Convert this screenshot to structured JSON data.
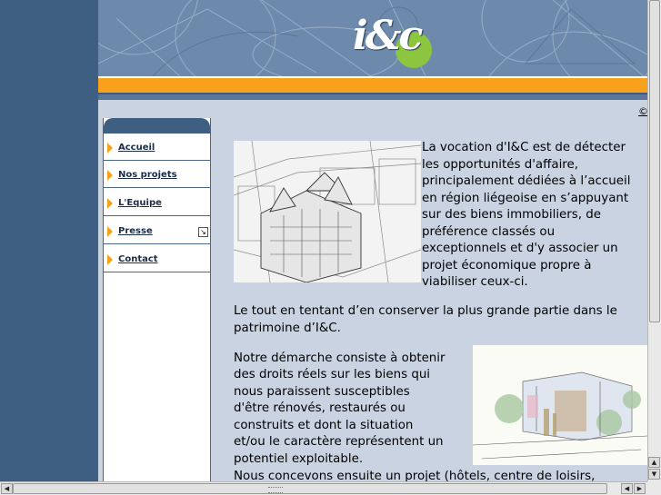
{
  "brand": {
    "logo_text": "i&c"
  },
  "copyright": "©",
  "nav": {
    "items": [
      {
        "label": "Accueil"
      },
      {
        "label": "Nos projets"
      },
      {
        "label": "L'Equipe"
      },
      {
        "label": "Presse"
      },
      {
        "label": "Contact"
      }
    ]
  },
  "content": {
    "p1_lines": [
      "La vocation d'I&C est de détecter",
      "les opportunités d'affaire,",
      "principalement dédiées à l’accueil",
      "en région liégeoise en s’appuyant",
      "sur des biens immobiliers, de",
      "préférence classés ou",
      "exceptionnels et d'y associer un",
      "projet économique propre à",
      "viabiliser ceux-ci."
    ],
    "p2_lines": [
      "Le tout en tentant d’en conserver la plus grande partie dans le",
      "patrimoine d’I&C."
    ],
    "p3_lines": [
      "Notre démarche consiste à obtenir",
      "des droits réels sur les biens qui",
      "nous paraissent susceptibles",
      "d'être rénovés, restaurés ou",
      "construits et dont la situation",
      "et/ou le caractère représentent un",
      "potentiel exploitable."
    ],
    "p4_line": "Nous concevons ensuite un projet (hôtels, centre de loisirs,"
  },
  "colors": {
    "sidebar": "#3f5f82",
    "frame": "#c9d3e1",
    "accent_orange": "#f7a21a",
    "logo_green": "#8cc63f"
  }
}
